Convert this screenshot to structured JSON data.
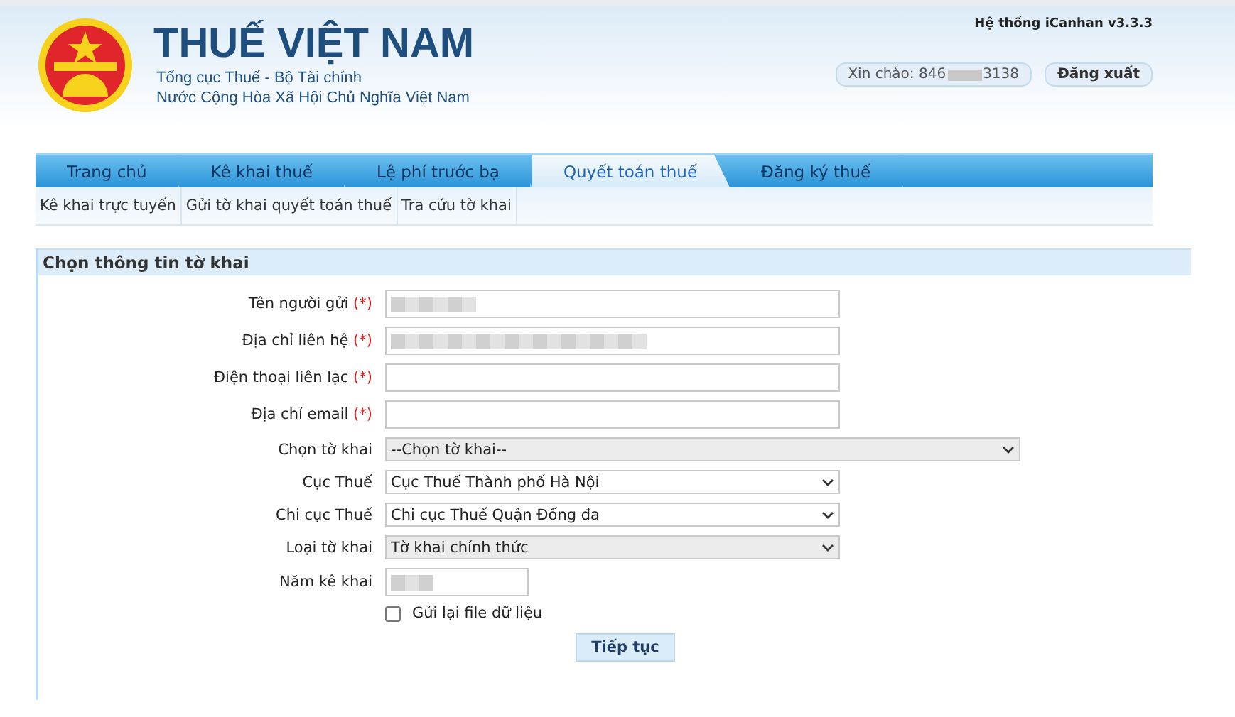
{
  "header": {
    "title": "THUẾ VIỆT NAM",
    "subtitles": [
      "Tổng cục Thuế - Bộ Tài chính",
      "Nước Cộng Hòa Xã Hội Chủ Nghĩa Việt Nam"
    ],
    "system": "Hệ thống iCanhan v3.3.3",
    "greeting_prefix": "Xin chào: 846",
    "greeting_suffix": "3138",
    "greeting_redacted": true,
    "logout": "Đăng xuất"
  },
  "tabs": [
    {
      "label": "Trang chủ",
      "selected": false
    },
    {
      "label": "Kê khai thuế",
      "selected": false
    },
    {
      "label": "Lệ phí trước bạ",
      "selected": false
    },
    {
      "label": "Quyết toán thuế",
      "selected": true
    },
    {
      "label": "Đăng ký thuế",
      "selected": false
    }
  ],
  "subnav": [
    "Kê khai trực tuyến",
    "Gửi tờ khai quyết toán thuế",
    "Tra cứu tờ khai"
  ],
  "form": {
    "title": "Chọn thông tin tờ khai",
    "fields": [
      {
        "kind": "text",
        "label": "Tên người gửi",
        "required_mark": "(*)",
        "redacted": true
      },
      {
        "kind": "text",
        "label": "Địa chỉ liên hệ",
        "required_mark": "(*)",
        "redacted": true
      },
      {
        "kind": "text",
        "label": "Điện thoại liên lạc",
        "required_mark": "(*)",
        "redacted": false
      },
      {
        "kind": "text",
        "label": "Địa chỉ email",
        "required_mark": "(*)",
        "redacted": false
      },
      {
        "kind": "wideselect",
        "label": "Chọn tờ khai",
        "value": "--Chọn tờ khai--"
      },
      {
        "kind": "select",
        "label": "Cục Thuế",
        "value": "Cục Thuế Thành phố Hà Nội"
      },
      {
        "kind": "select",
        "label": "Chi cục Thuế",
        "value": "Chi cục Thuế Quận Đống đa"
      },
      {
        "kind": "select",
        "label": "Loại tờ khai",
        "value": "Tờ khai chính thức"
      },
      {
        "kind": "shorttext",
        "label": "Năm kê khai",
        "redacted": true
      }
    ],
    "checkbox": {
      "label": "Gửi lại file dữ liệu",
      "checked": false
    },
    "submit": "Tiếp tục"
  }
}
